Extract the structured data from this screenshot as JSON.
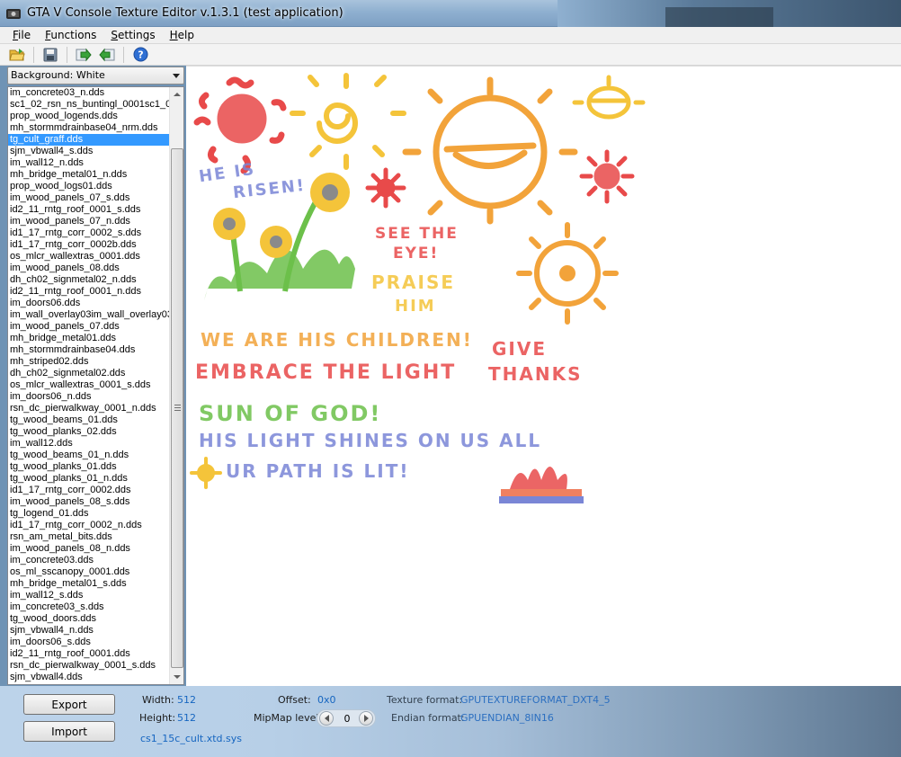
{
  "window": {
    "title": "GTA V Console Texture Editor v.1.3.1 (test application)"
  },
  "menu": [
    {
      "label": "File",
      "key": "F",
      "rest": "ile"
    },
    {
      "label": "Functions",
      "key": "F",
      "rest": "unctions"
    },
    {
      "label": "Settings",
      "key": "S",
      "rest": "ettings"
    },
    {
      "label": "Help",
      "key": "H",
      "rest": "elp"
    }
  ],
  "toolbar": {
    "icons": [
      "open-folder-icon",
      "save-icon",
      "export-arrow-icon",
      "import-arrow-icon",
      "help-icon"
    ]
  },
  "background_select": {
    "value": "Background: White"
  },
  "file_list": {
    "selected_index": 4,
    "items": [
      "im_concrete03_n.dds",
      "sc1_02_rsn_ns_buntingl_0001sc1_0",
      "prop_wood_logends.dds",
      "mh_stormmdrainbase04_nrm.dds",
      "tg_cult_graff.dds",
      "sjm_vbwall4_s.dds",
      "im_wall12_n.dds",
      "mh_bridge_metal01_n.dds",
      "prop_wood_logs01.dds",
      "im_wood_panels_07_s.dds",
      "id2_11_rntg_roof_0001_s.dds",
      "im_wood_panels_07_n.dds",
      "id1_17_rntg_corr_0002_s.dds",
      "id1_17_rntg_corr_0002b.dds",
      "os_mlcr_wallextras_0001.dds",
      "im_wood_panels_08.dds",
      "dh_ch02_signmetal02_n.dds",
      "id2_11_rntg_roof_0001_n.dds",
      "im_doors06.dds",
      "im_wall_overlay03im_wall_overlay03",
      "im_wood_panels_07.dds",
      "mh_bridge_metal01.dds",
      "mh_stormmdrainbase04.dds",
      "mh_striped02.dds",
      "dh_ch02_signmetal02.dds",
      "os_mlcr_wallextras_0001_s.dds",
      "im_doors06_n.dds",
      "rsn_dc_pierwalkway_0001_n.dds",
      "tg_wood_beams_01.dds",
      "tg_wood_planks_02.dds",
      "im_wall12.dds",
      "tg_wood_beams_01_n.dds",
      "tg_wood_planks_01.dds",
      "tg_wood_planks_01_n.dds",
      "id1_17_rntg_corr_0002.dds",
      "im_wood_panels_08_s.dds",
      "tg_logend_01.dds",
      "id1_17_rntg_corr_0002_n.dds",
      "rsn_am_metal_bits.dds",
      "im_wood_panels_08_n.dds",
      "im_concrete03.dds",
      "os_ml_sscanopy_0001.dds",
      "mh_bridge_metal01_s.dds",
      "im_wall12_s.dds",
      "im_concrete03_s.dds",
      "tg_wood_doors.dds",
      "sjm_vbwall4_n.dds",
      "im_doors06_s.dds",
      "id2_11_rntg_roof_0001.dds",
      "rsn_dc_pierwalkway_0001_s.dds",
      "sjm_vbwall4.dds"
    ]
  },
  "graffiti": {
    "he_is": "HE IS",
    "risen": "RISEN!",
    "see_the": "SEE THE",
    "eye": "EYE!",
    "praise": "PRAISE",
    "him": "HIM",
    "children": "WE ARE HIS CHILDREN!",
    "give": "GIVE",
    "thanks": "THANKS",
    "embrace": "EMBRACE THE LIGHT",
    "sun_of_god": "SUN OF GOD!",
    "shines": "HIS LIGHT SHINES ON US ALL",
    "path": "UR PATH IS LIT!",
    "colors": {
      "red": "#e84a4a",
      "orange": "#f2a33a",
      "yellow": "#f4c43a",
      "green": "#6cc04a",
      "blue": "#7a86d6",
      "gray": "#8a8a8a"
    }
  },
  "bottom": {
    "export_label": "Export",
    "import_label": "Import",
    "width_label": "Width:",
    "width_value": "512",
    "height_label": "Height:",
    "height_value": "512",
    "offset_label": "Offset:",
    "offset_value": "0x0",
    "mipmap_label": "MipMap level:",
    "mipmap_value": "0",
    "texture_format_label": "Texture format:",
    "texture_format_value": "GPUTEXTUREFORMAT_DXT4_5",
    "endian_format_label": "Endian format:",
    "endian_format_value": "GPUENDIAN_8IN16",
    "file_name": "cs1_15c_cult.xtd.sys"
  }
}
